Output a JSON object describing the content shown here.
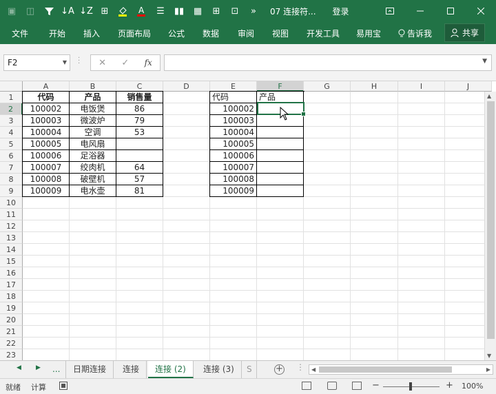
{
  "titlebar": {
    "title": "07 连接符...",
    "login": "登录"
  },
  "ribbon": {
    "tabs": [
      "文件",
      "开始",
      "插入",
      "页面布局",
      "公式",
      "数据",
      "审阅",
      "视图",
      "开发工具",
      "易用宝"
    ],
    "tell_me": "告诉我",
    "share": "共享"
  },
  "formula_bar": {
    "name_box": "F2",
    "fx": "fx",
    "value": ""
  },
  "columns": [
    "A",
    "B",
    "C",
    "D",
    "E",
    "F",
    "G",
    "H",
    "I",
    "J"
  ],
  "rows": [
    "1",
    "2",
    "3",
    "4",
    "5",
    "6",
    "7",
    "8",
    "9",
    "10",
    "11",
    "12",
    "13",
    "14",
    "15",
    "16",
    "17",
    "18",
    "19",
    "20",
    "21",
    "22",
    "23"
  ],
  "table1": {
    "headers": [
      "代码",
      "产品",
      "销售量"
    ],
    "rows": [
      [
        "100002",
        "电饭煲",
        "86"
      ],
      [
        "100003",
        "微波炉",
        "79"
      ],
      [
        "100004",
        "空调",
        "53"
      ],
      [
        "100005",
        "电风扇",
        ""
      ],
      [
        "100006",
        "足浴器",
        ""
      ],
      [
        "100007",
        "绞肉机",
        "64"
      ],
      [
        "100008",
        "破壁机",
        "57"
      ],
      [
        "100009",
        "电水壶",
        "81"
      ]
    ]
  },
  "table2": {
    "headers": [
      "代码",
      "产品"
    ],
    "rows": [
      [
        "100002",
        ""
      ],
      [
        "100003",
        ""
      ],
      [
        "100004",
        ""
      ],
      [
        "100005",
        ""
      ],
      [
        "100006",
        ""
      ],
      [
        "100007",
        ""
      ],
      [
        "100008",
        ""
      ],
      [
        "100009",
        ""
      ]
    ]
  },
  "sheet_tabs": {
    "ellipsis": "...",
    "tabs": [
      "日期连接",
      "连接",
      "连接 (2)",
      "连接 (3)",
      "S"
    ],
    "active_index": 2
  },
  "statusbar": {
    "ready": "就绪",
    "calc": "计算",
    "zoom": "100%"
  }
}
